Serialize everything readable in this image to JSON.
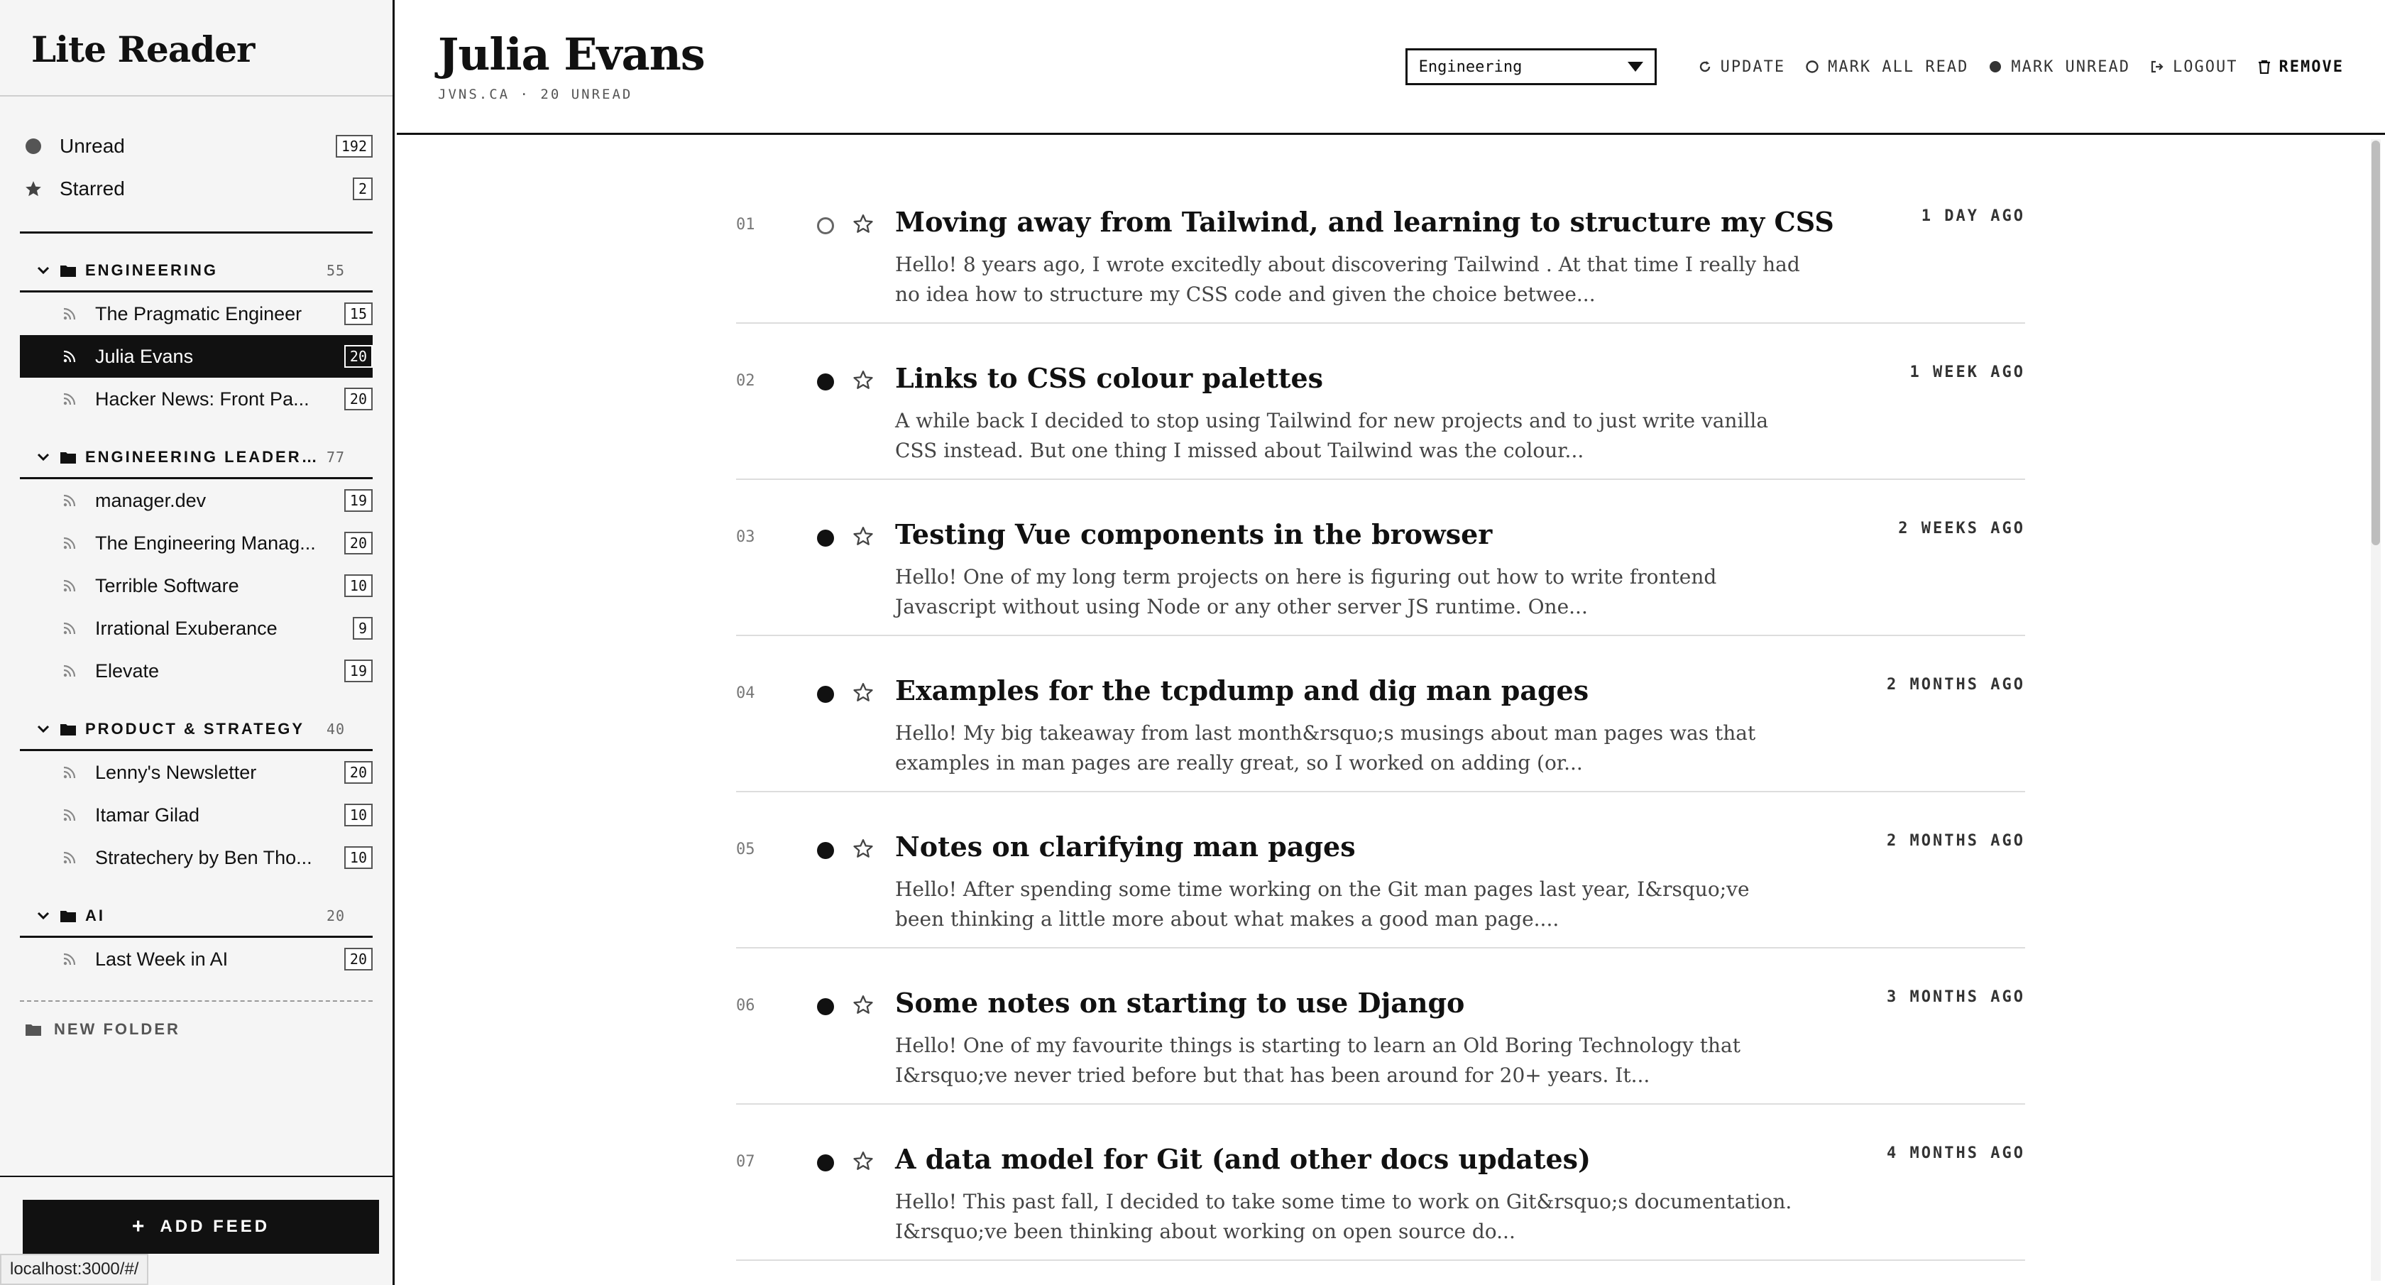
{
  "app": {
    "title": "Lite Reader"
  },
  "sidebar": {
    "special": [
      {
        "label": "Unread",
        "count": "192",
        "icon": "circle-icon"
      },
      {
        "label": "Starred",
        "count": "2",
        "icon": "star-icon"
      }
    ],
    "folders": [
      {
        "name": "ENGINEERING",
        "count": "55",
        "feeds": [
          {
            "label": "The Pragmatic Engineer",
            "count": "15"
          },
          {
            "label": "Julia Evans",
            "count": "20",
            "active": true
          },
          {
            "label": "Hacker News: Front Pa...",
            "count": "20"
          }
        ]
      },
      {
        "name": "ENGINEERING LEADERSH...",
        "count": "77",
        "feeds": [
          {
            "label": "manager.dev",
            "count": "19"
          },
          {
            "label": "The Engineering Manag...",
            "count": "20"
          },
          {
            "label": "Terrible Software",
            "count": "10"
          },
          {
            "label": "Irrational Exuberance",
            "count": "9"
          },
          {
            "label": "Elevate",
            "count": "19"
          }
        ]
      },
      {
        "name": "PRODUCT & STRATEGY",
        "count": "40",
        "feeds": [
          {
            "label": "Lenny's Newsletter",
            "count": "20"
          },
          {
            "label": "Itamar Gilad",
            "count": "10"
          },
          {
            "label": "Stratechery by Ben Tho...",
            "count": "10"
          }
        ]
      },
      {
        "name": "AI",
        "count": "20",
        "feeds": [
          {
            "label": "Last Week in AI",
            "count": "20"
          }
        ]
      }
    ],
    "new_folder_label": "NEW FOLDER",
    "add_feed_label": "ADD FEED"
  },
  "status_url": "localhost:3000/#/",
  "header": {
    "title": "Julia Evans",
    "subtitle": "JVNS.CA · 20 UNREAD",
    "folder_select": "Engineering",
    "actions": {
      "update": "UPDATE",
      "mark_all_read": "MARK ALL READ",
      "mark_unread": "MARK UNREAD",
      "logout": "LOGOUT",
      "remove": "REMOVE"
    }
  },
  "articles": [
    {
      "num": "01",
      "read": true,
      "title": "Moving away from Tailwind, and learning to structure my CSS",
      "snippet": "Hello! 8 years ago, I wrote excitedly about discovering Tailwind . At that time I really had no idea how to structure my CSS code and given the choice betwee...",
      "time": "1 DAY AGO"
    },
    {
      "num": "02",
      "read": false,
      "title": "Links to CSS colour palettes",
      "snippet": "A while back I decided to stop using Tailwind for new projects and to just write vanilla CSS instead. But one thing I missed about Tailwind was the colour...",
      "time": "1 WEEK AGO"
    },
    {
      "num": "03",
      "read": false,
      "title": "Testing Vue components in the browser",
      "snippet": "Hello! One of my long term projects on here is figuring out how to write frontend Javascript without using Node or any other server JS runtime. One...",
      "time": "2 WEEKS AGO"
    },
    {
      "num": "04",
      "read": false,
      "title": "Examples for the tcpdump and dig man pages",
      "snippet": "Hello! My big takeaway from last month&rsquo;s musings about man pages was that examples in man pages are really great, so I worked on adding (or...",
      "time": "2 MONTHS AGO"
    },
    {
      "num": "05",
      "read": false,
      "title": "Notes on clarifying man pages",
      "snippet": "Hello! After spending some time working on the Git man pages last year, I&rsquo;ve been thinking a little more about what makes a good man page....",
      "time": "2 MONTHS AGO"
    },
    {
      "num": "06",
      "read": false,
      "title": "Some notes on starting to use Django",
      "snippet": "Hello! One of my favourite things is starting to learn an Old Boring Technology that I&rsquo;ve never tried before but that has been around for 20+ years. It...",
      "time": "3 MONTHS AGO"
    },
    {
      "num": "07",
      "read": false,
      "title": "A data model for Git (and other docs updates)",
      "snippet": "Hello! This past fall, I decided to take some time to work on Git&rsquo;s documentation. I&rsquo;ve been thinking about working on open source do...",
      "time": "4 MONTHS AGO"
    }
  ]
}
